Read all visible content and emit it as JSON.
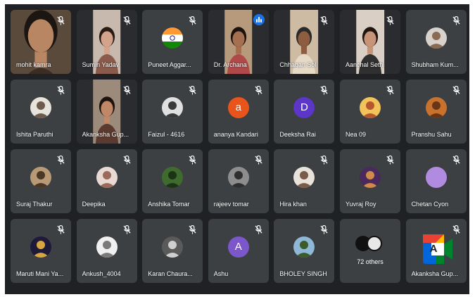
{
  "participants": [
    {
      "name": "mohit kamra",
      "kind": "video",
      "bg": "#5a4a3c",
      "skin": "#b98663",
      "hair": "#1c1612",
      "cloth": "#3b2c24",
      "muted": true
    },
    {
      "name": "Sumin Yadav",
      "kind": "video",
      "bg": "#c7b9ad",
      "skin": "#d3a38b",
      "hair": "#2a1a14",
      "cloth": "#8a5a4c",
      "muted": true
    },
    {
      "name": "Puneet Aggar...",
      "kind": "avatar",
      "avatar": "flag-india",
      "muted": true
    },
    {
      "name": "Dr. Archana",
      "kind": "video",
      "bg": "#b79a7c",
      "skin": "#a66f4f",
      "hair": "#1b120e",
      "cloth": "#b04a4a",
      "muted": false,
      "speaking": true
    },
    {
      "name": "Chhagan Sol",
      "kind": "video",
      "bg": "#cdbba4",
      "skin": "#8e5c3e",
      "hair": "#2a2a2a",
      "cloth": "#e6d9c6",
      "muted": true
    },
    {
      "name": "Aanchal Sethi",
      "kind": "video",
      "bg": "#d9cfc4",
      "skin": "#c89479",
      "hair": "#20150f",
      "cloth": "#2f2f2f",
      "muted": true
    },
    {
      "name": "Shubham Kum...",
      "kind": "avatar",
      "avatar": "photo",
      "avatar_bg": "#d8d2cc",
      "avatar_fg": "#8a6a55",
      "muted": true
    },
    {
      "name": "Ishita Paruthi",
      "kind": "avatar",
      "avatar": "photo",
      "avatar_bg": "#e7e2da",
      "avatar_fg": "#6e5a4c",
      "muted": true
    },
    {
      "name": "Akanksha Gup...",
      "kind": "video",
      "bg": "#9c8a7a",
      "skin": "#c08866",
      "hair": "#1d140f",
      "cloth": "#5b3b30",
      "muted": true
    },
    {
      "name": "Faizul - 4616",
      "kind": "avatar",
      "avatar": "photo",
      "avatar_bg": "#e0e0e0",
      "avatar_fg": "#3a3a3a",
      "muted": true
    },
    {
      "name": "ananya Kandari",
      "kind": "avatar",
      "avatar": "letter",
      "letter": "a",
      "color": "#e8541b",
      "muted": true
    },
    {
      "name": "Deeksha Rai",
      "kind": "avatar",
      "avatar": "letter",
      "letter": "D",
      "color": "#5c35c9",
      "muted": true
    },
    {
      "name": "Nea 09",
      "kind": "avatar",
      "avatar": "photo",
      "avatar_bg": "#f2c35a",
      "avatar_fg": "#b5572e",
      "muted": true
    },
    {
      "name": "Pranshu Sahu",
      "kind": "avatar",
      "avatar": "photo",
      "avatar_bg": "#c9722e",
      "avatar_fg": "#6a3417",
      "muted": true
    },
    {
      "name": "Suraj Thakur",
      "kind": "avatar",
      "avatar": "photo",
      "avatar_bg": "#b89a76",
      "avatar_fg": "#4a3726",
      "muted": true
    },
    {
      "name": "Deepika",
      "kind": "avatar",
      "avatar": "photo",
      "avatar_bg": "#ead9d2",
      "avatar_fg": "#9a6a5a",
      "muted": true
    },
    {
      "name": "Anshika Tomar",
      "kind": "avatar",
      "avatar": "photo",
      "avatar_bg": "#3f6b2f",
      "avatar_fg": "#1c3416",
      "muted": true
    },
    {
      "name": "rajeev tomar",
      "kind": "avatar",
      "avatar": "photo",
      "avatar_bg": "#8d8d8d",
      "avatar_fg": "#2f2f2f",
      "muted": true
    },
    {
      "name": "Hira khan",
      "kind": "avatar",
      "avatar": "photo",
      "avatar_bg": "#e9e2db",
      "avatar_fg": "#7a5a48",
      "muted": true
    },
    {
      "name": "Yuvraj Roy",
      "kind": "avatar",
      "avatar": "photo",
      "avatar_bg": "#4a2a5c",
      "avatar_fg": "#d08a4a",
      "muted": true
    },
    {
      "name": "Chetan Cyon",
      "kind": "avatar",
      "avatar": "blank",
      "color": "#b08be0",
      "muted": true
    },
    {
      "name": "Maruti Mani Ya...",
      "kind": "avatar",
      "avatar": "photo",
      "avatar_bg": "#1f1a3a",
      "avatar_fg": "#d8a640",
      "muted": true
    },
    {
      "name": "Ankush_4004",
      "kind": "avatar",
      "avatar": "photo",
      "avatar_bg": "#f0f0f0",
      "avatar_fg": "#7a7a7a",
      "muted": true
    },
    {
      "name": "Karan Chaura...",
      "kind": "avatar",
      "avatar": "photo",
      "avatar_bg": "#5a5a5a",
      "avatar_fg": "#cfcfcf",
      "muted": true
    },
    {
      "name": "Ashu",
      "kind": "avatar",
      "avatar": "letter",
      "letter": "A",
      "color": "#7b57c9",
      "muted": true
    },
    {
      "name": "BHOLEY SINGH",
      "kind": "avatar",
      "avatar": "photo",
      "avatar_bg": "#8fb7d6",
      "avatar_fg": "#3d5a2a",
      "muted": true
    },
    {
      "name": "72 others",
      "kind": "others"
    },
    {
      "name": "Akanksha Gup...",
      "kind": "meet-logo",
      "muted": true,
      "logo_letter": "A"
    }
  ],
  "colors": {
    "frame_bg": "#202124",
    "tile_bg": "#3c4043",
    "speaking_accent": "#1a73e8",
    "meet_green": "#00832d",
    "meet_blue": "#0066da",
    "meet_yellow": "#ffba00",
    "meet_red": "#e94235"
  }
}
